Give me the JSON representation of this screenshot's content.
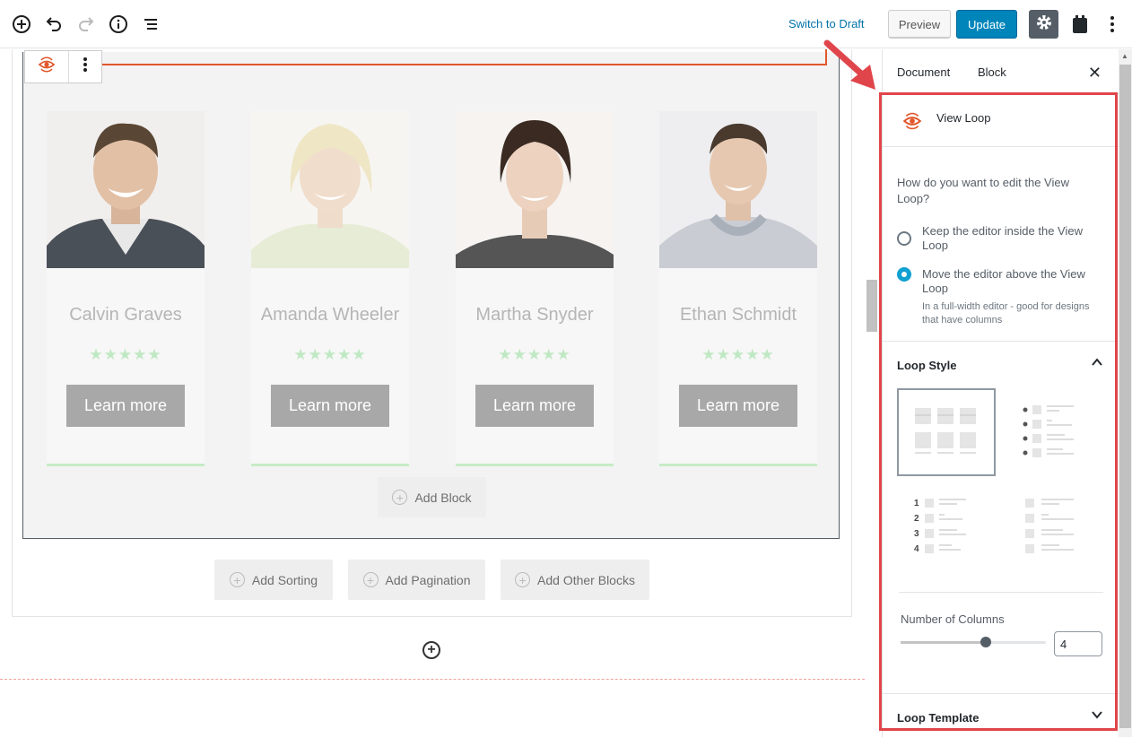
{
  "topbar": {
    "switch_to_draft": "Switch to Draft",
    "preview_label": "Preview",
    "update_label": "Update",
    "icons": [
      "add-block-icon",
      "undo-icon",
      "redo-icon",
      "info-icon",
      "outline-icon",
      "gear-icon",
      "toolset-icon",
      "more-menu-icon"
    ]
  },
  "cards": [
    {
      "name": "Calvin Graves",
      "stars": "★★★★★",
      "button": "Learn more"
    },
    {
      "name": "Amanda Wheeler",
      "stars": "★★★★★",
      "button": "Learn more"
    },
    {
      "name": "Martha Snyder",
      "stars": "★★★★★",
      "button": "Learn more"
    },
    {
      "name": "Ethan Schmidt",
      "stars": "★★★★★",
      "button": "Learn more"
    }
  ],
  "canvas": {
    "add_block": "Add Block",
    "add_sorting": "Add Sorting",
    "add_pagination": "Add Pagination",
    "add_other_blocks": "Add Other Blocks"
  },
  "sidebar": {
    "tab_document": "Document",
    "tab_block": "Block",
    "close": "✕",
    "block_name": "View Loop",
    "question": "How do you want to edit the View Loop?",
    "option_inside": "Keep the editor inside the View Loop",
    "option_above": "Move the editor above the View Loop",
    "option_above_help": "In a full-width editor - good for designs that have columns",
    "selected_option": "above",
    "loop_style_title": "Loop Style",
    "loop_style_selected": "grid",
    "num_columns_label": "Number of Columns",
    "num_columns_value": "4",
    "loop_template_title": "Loop Template",
    "list_numbers": [
      "1",
      "2",
      "3",
      "4"
    ]
  },
  "colors": {
    "accent_blue": "#0085ba",
    "highlight_red": "#e0454b",
    "brand_orange": "#e1562b"
  }
}
